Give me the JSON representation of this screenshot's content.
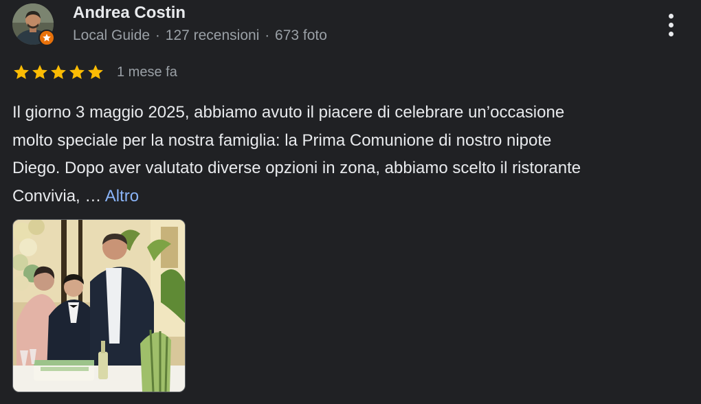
{
  "review": {
    "author": {
      "name": "Andrea Costin",
      "level": "Local Guide",
      "reviews": "127 recensioni",
      "photos": "673 foto",
      "separator": "·",
      "badge_icon": "local-guide-star-icon"
    },
    "rating": {
      "stars": 5,
      "max_stars": 5,
      "star_color": "#fbbc04",
      "date": "1 mese fa"
    },
    "text_lines": [
      "Il giorno 3 maggio 2025, abbiamo avuto il piacere di celebrare un’occasione",
      "molto speciale per la nostra famiglia: la Prima Comunione di nostro nipote",
      "Diego. Dopo aver valutato diverse opzioni in zona, abbiamo scelto il ristorante",
      "Convivia, …"
    ],
    "more_label": "Altro",
    "menu_icon": "more-vert-icon",
    "photo_icon": "review-photo"
  },
  "colors": {
    "background": "#202124",
    "text_primary": "#e8eaed",
    "text_secondary": "#9aa0a6",
    "link": "#8ab4f8",
    "badge": "#e8710a"
  }
}
